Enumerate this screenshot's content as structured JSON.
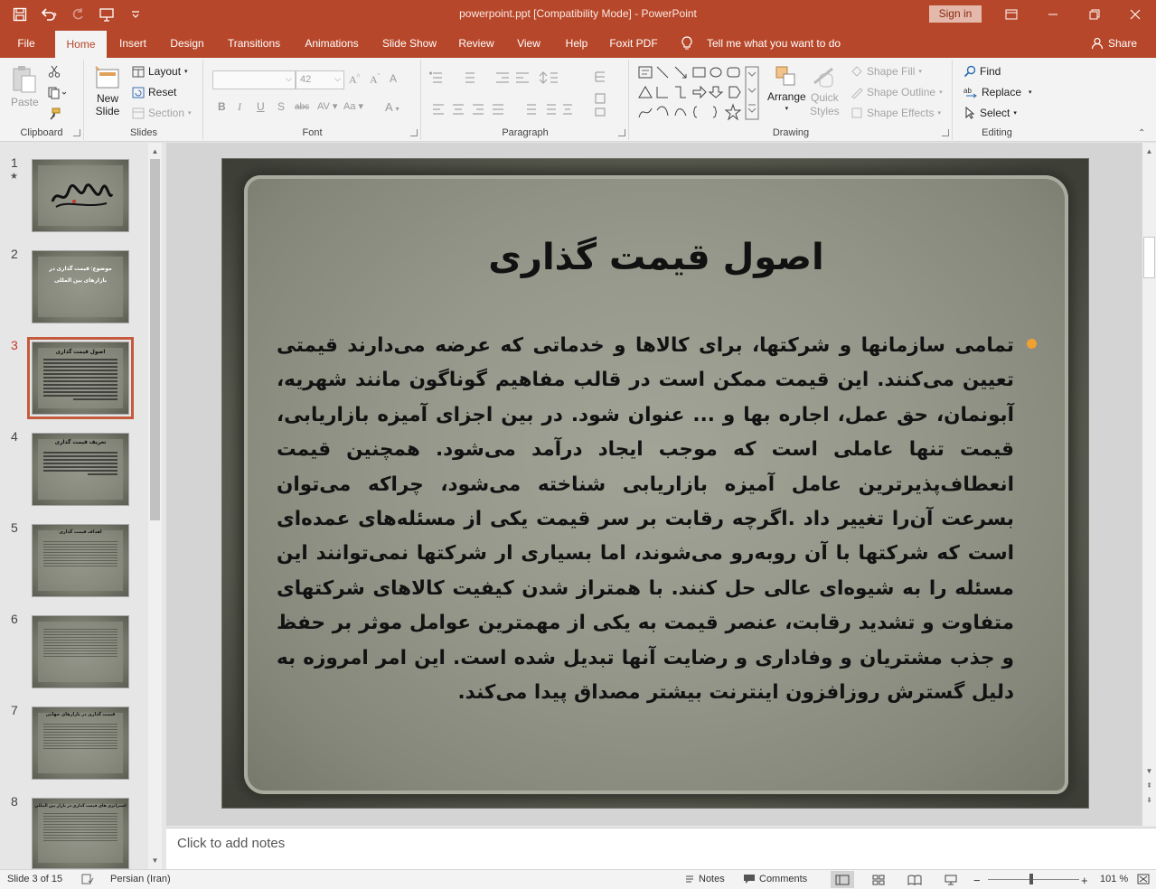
{
  "window": {
    "title": "powerpoint.ppt [Compatibility Mode]  -  PowerPoint",
    "sign_in": "Sign in"
  },
  "tabs": [
    "File",
    "Home",
    "Insert",
    "Design",
    "Transitions",
    "Animations",
    "Slide Show",
    "Review",
    "View",
    "Help",
    "Foxit PDF"
  ],
  "active_tab": "Home",
  "tell_me": "Tell me what you want to do",
  "share": "Share",
  "ribbon": {
    "clipboard": {
      "label": "Clipboard",
      "paste": "Paste"
    },
    "slides": {
      "label": "Slides",
      "new_slide_1": "New",
      "new_slide_2": "Slide",
      "layout": "Layout",
      "reset": "Reset",
      "section": "Section"
    },
    "font": {
      "label": "Font",
      "size": "42"
    },
    "paragraph": {
      "label": "Paragraph"
    },
    "drawing": {
      "label": "Drawing",
      "arrange": "Arrange",
      "quick_styles_1": "Quick",
      "quick_styles_2": "Styles",
      "shape_fill": "Shape Fill",
      "shape_outline": "Shape Outline",
      "shape_effects": "Shape Effects"
    },
    "editing": {
      "label": "Editing",
      "find": "Find",
      "replace": "Replace",
      "select": "Select"
    }
  },
  "thumbnails": [
    {
      "num": "1",
      "star": "★"
    },
    {
      "num": "2",
      "title": "موضوع: قیمت گذاری در بازارهای بین المللی"
    },
    {
      "num": "3",
      "title": "اصول قیمت گذاری",
      "selected": true
    },
    {
      "num": "4",
      "title": "تعریف قیمت گذاری"
    },
    {
      "num": "5",
      "title": "اهداف قیمت گذاری"
    },
    {
      "num": "6",
      "title": ""
    },
    {
      "num": "7",
      "title": "قیمت گذاری در بازارهای جهانی"
    },
    {
      "num": "8",
      "title": "استراتژی های قیمت گذاری در بازار بین المللی"
    }
  ],
  "slide": {
    "title": "اصول قیمت گذاری",
    "body": "تمامی سازمانها و شرکتها، برای کالاها و خدماتی که عرضه می‌دارند قیمتی تعیین می‌کنند. این قیمت ممکن است در قالب مفاهیم گوناگون مانند شهریه، آبونمان، حق عمل، اجاره بها و ... عنوان شود.  در بین اجزای آمیزه بازاریابی، قیمت تنها عاملی است که موجب ایجاد درآمد می‌شود. همچنین قیمت انعطاف‌پذیرترین عامل آمیزه بازاریابی شناخته می‌شود، چراکه می‌توان بسرعت آن‌را تغییر داد .اگرچه رقابت بر سر قیمت یکی از مسئله‌های عمده‌ای است که شرکتها با آن روبه‌رو می‌شوند، اما بسیاری ار شرکتها نمی‌توانند این مسئله را به شیوه‌ای عالی حل کنند.  با همتراز شدن کیفیت کالاهای شرکتهای متفاوت و تشدید رقابت، عنصر قیمت به یکی از مهمترین عوامل موثر بر حفظ و جذب مشتریان و وفاداری و رضایت آنها تبدیل شده است. این امر امروزه به دلیل گسترش روزافزون اینترنت بیشتر مصداق پیدا می‌کند."
  },
  "notes_placeholder": "Click to add notes",
  "status": {
    "slide_of": "Slide 3 of 15",
    "language": "Persian (Iran)",
    "notes": "Notes",
    "comments": "Comments",
    "zoom": "101 %"
  },
  "colors": {
    "accent": "#b7472a",
    "bullet": "#f0a030"
  }
}
